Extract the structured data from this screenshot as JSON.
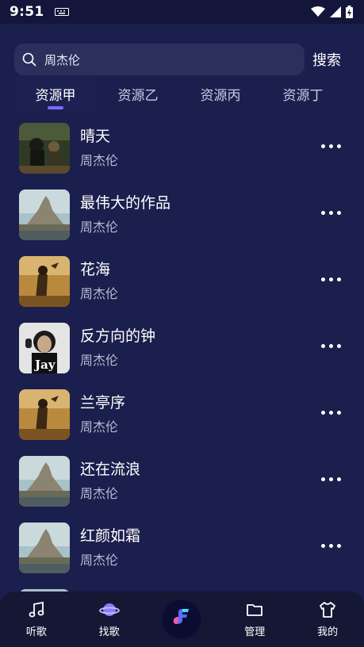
{
  "status": {
    "time": "9:51"
  },
  "search": {
    "value": "周杰伦",
    "button_label": "搜索"
  },
  "tabs": [
    {
      "label": "资源甲"
    },
    {
      "label": "资源乙"
    },
    {
      "label": "资源丙"
    },
    {
      "label": "资源丁"
    }
  ],
  "songs": [
    {
      "title": "晴天",
      "artist": "周杰伦"
    },
    {
      "title": "最伟大的作品",
      "artist": "周杰伦"
    },
    {
      "title": "花海",
      "artist": "周杰伦"
    },
    {
      "title": "反方向的钟",
      "artist": "周杰伦"
    },
    {
      "title": "兰亭序",
      "artist": "周杰伦"
    },
    {
      "title": "还在流浪",
      "artist": "周杰伦"
    },
    {
      "title": "红颜如霜",
      "artist": "周杰伦"
    }
  ],
  "cover_texts": {
    "jay": "Jay"
  },
  "nav": [
    {
      "label": "听歌",
      "icon": "music-note-icon"
    },
    {
      "label": "找歌",
      "icon": "planet-icon"
    },
    {
      "label": "",
      "icon": "app-logo-icon"
    },
    {
      "label": "管理",
      "icon": "folder-icon"
    },
    {
      "label": "我的",
      "icon": "shirt-icon"
    }
  ],
  "colors": {
    "background": "#1b1f4d",
    "accent": "#7a6cff",
    "search_bg": "#2a2f5c"
  }
}
